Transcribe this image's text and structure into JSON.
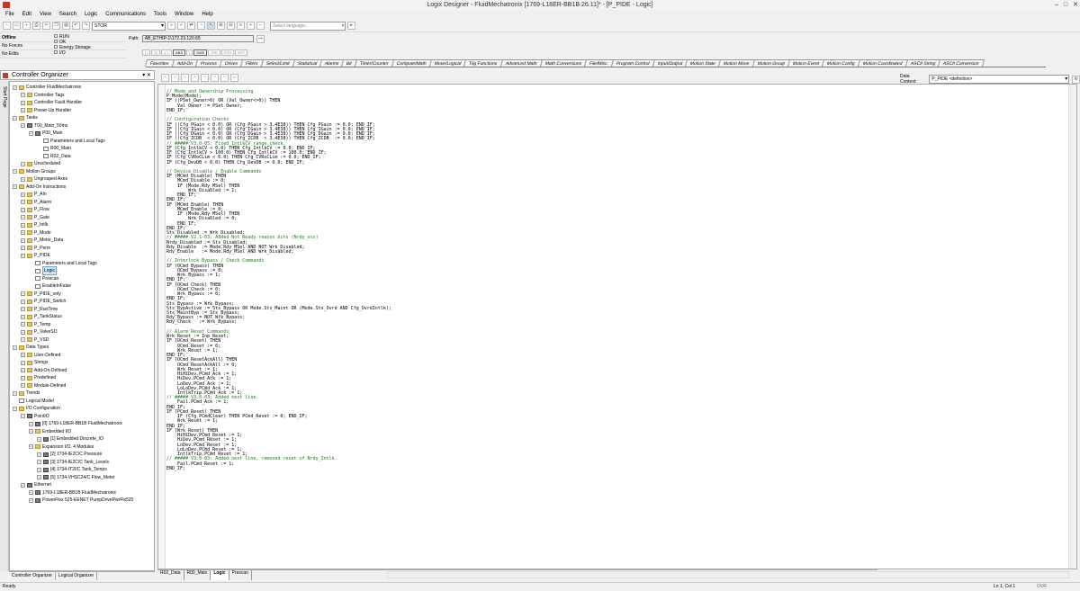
{
  "window": {
    "title": "Logix Designer - FluidMechatronix [1769-L18ER-BB1B 26.11]* - [P_PIDE - Logic]"
  },
  "menu": [
    "File",
    "Edit",
    "View",
    "Search",
    "Logic",
    "Communications",
    "Tools",
    "Window",
    "Help"
  ],
  "toolbar": {
    "search_combo": "STOR",
    "language_placeholder": "Select language..."
  },
  "controller_status": {
    "mode": "Offline",
    "forces": "No Forces",
    "edits": "No Edits",
    "leds": [
      "RUN",
      "OK",
      "Energy Storage",
      "I/O"
    ]
  },
  "path": {
    "label": "Path:",
    "value": "AB_ETHIP-1\\172.23.120.65"
  },
  "ladder_buttons": [
    "[ ]",
    "]/[",
    "-( )-",
    "ABS",
    "]",
    "SIZE",
    "JSR",
    "OTU",
    "RET"
  ],
  "instruction_tabs": [
    "Favorites",
    "Add-On",
    "Process",
    "Drives",
    "Filters",
    "Select/Limit",
    "Statistical",
    "Alarms",
    "Bit",
    "Timer/Counter",
    "Compute/Math",
    "Move/Logical",
    "Trig Functions",
    "Advanced Math",
    "Math Conversions",
    "File/Misc.",
    "Program Control",
    "Input/Output",
    "Motion State",
    "Motion Move",
    "Motion Group",
    "Motion Event",
    "Motion Config",
    "Motion Coordinated",
    "ASCII String",
    "ASCII Conversion"
  ],
  "organizer": {
    "title": "Controller Organizer",
    "vertical_tab": "Start Page",
    "bottom_tabs": [
      "Controller Organizer",
      "Logical Organizer"
    ],
    "tree": [
      {
        "level": 0,
        "text": "Controller FluidMechatronix",
        "icon": "folder"
      },
      {
        "level": 1,
        "text": "Controller Tags",
        "icon": "folder"
      },
      {
        "level": 1,
        "text": "Controller Fault Handler",
        "icon": "folder"
      },
      {
        "level": 1,
        "text": "Power-Up Handler",
        "icon": "folder"
      },
      {
        "level": 0,
        "text": "Tasks",
        "icon": "folder"
      },
      {
        "level": 1,
        "text": "T00_Main_50ms",
        "icon": "task"
      },
      {
        "level": 2,
        "text": "P00_Main",
        "icon": "program"
      },
      {
        "level": 3,
        "text": "Parameters and Local Tags",
        "icon": "doc"
      },
      {
        "level": 3,
        "text": "R00_Main",
        "icon": "doc"
      },
      {
        "level": 3,
        "text": "R02_Data",
        "icon": "doc"
      },
      {
        "level": 1,
        "text": "Unscheduled",
        "icon": "folder"
      },
      {
        "level": 0,
        "text": "Motion Groups",
        "icon": "folder"
      },
      {
        "level": 1,
        "text": "Ungrouped Axes",
        "icon": "folder"
      },
      {
        "level": 0,
        "text": "Add-On Instructions",
        "icon": "folder"
      },
      {
        "level": 1,
        "text": "P_AIn",
        "icon": "folder"
      },
      {
        "level": 1,
        "text": "P_Alarm",
        "icon": "folder"
      },
      {
        "level": 1,
        "text": "P_Flow",
        "icon": "folder"
      },
      {
        "level": 1,
        "text": "P_Gate",
        "icon": "folder"
      },
      {
        "level": 1,
        "text": "P_Intlk",
        "icon": "folder"
      },
      {
        "level": 1,
        "text": "P_Mode",
        "icon": "folder"
      },
      {
        "level": 1,
        "text": "P_Motor_Data",
        "icon": "folder"
      },
      {
        "level": 1,
        "text": "P_Perm",
        "icon": "folder"
      },
      {
        "level": 1,
        "text": "P_PIDE",
        "icon": "folder"
      },
      {
        "level": 2,
        "text": "Parameters and Local Tags",
        "icon": "doc"
      },
      {
        "level": 2,
        "text": "Logic",
        "icon": "doc",
        "selected": true
      },
      {
        "level": 2,
        "text": "Prescan",
        "icon": "doc"
      },
      {
        "level": 2,
        "text": "EnableInFalse",
        "icon": "doc"
      },
      {
        "level": 1,
        "text": "P_PIDE_only",
        "icon": "folder"
      },
      {
        "level": 1,
        "text": "P_PIDE_Switch",
        "icon": "folder"
      },
      {
        "level": 1,
        "text": "P_RunTime",
        "icon": "folder"
      },
      {
        "level": 1,
        "text": "P_TankStatus",
        "icon": "folder"
      },
      {
        "level": 1,
        "text": "P_Temp",
        "icon": "folder"
      },
      {
        "level": 1,
        "text": "P_ValveSO",
        "icon": "folder"
      },
      {
        "level": 1,
        "text": "P_VSD",
        "icon": "folder"
      },
      {
        "level": 0,
        "text": "Data Types",
        "icon": "folder"
      },
      {
        "level": 1,
        "text": "User-Defined",
        "icon": "folder"
      },
      {
        "level": 1,
        "text": "Strings",
        "icon": "folder"
      },
      {
        "level": 1,
        "text": "Add-On-Defined",
        "icon": "folder"
      },
      {
        "level": 1,
        "text": "Predefined",
        "icon": "folder"
      },
      {
        "level": 1,
        "text": "Module-Defined",
        "icon": "folder"
      },
      {
        "level": 0,
        "text": "Trends",
        "icon": "folder"
      },
      {
        "level": 0,
        "text": "Logical Model",
        "icon": "doc"
      },
      {
        "level": 0,
        "text": "I/O Configuration",
        "icon": "folder"
      },
      {
        "level": 1,
        "text": "PointIO",
        "icon": "module"
      },
      {
        "level": 2,
        "text": "[0] 1769-L18ER-BB1B FluidMechatronix",
        "icon": "module"
      },
      {
        "level": 2,
        "text": "Embedded I/O",
        "icon": "folder"
      },
      {
        "level": 3,
        "text": "[1] Embedded Discrete_IO",
        "icon": "module"
      },
      {
        "level": 2,
        "text": "Expansion I/O, 4 Modules",
        "icon": "folder"
      },
      {
        "level": 3,
        "text": "[2] 1734-IE2C/C Pressure",
        "icon": "module"
      },
      {
        "level": 3,
        "text": "[3] 1734-IE2C/C Tank_Levels",
        "icon": "module"
      },
      {
        "level": 3,
        "text": "[4] 1734-IT2I/C Tank_Temps",
        "icon": "module"
      },
      {
        "level": 3,
        "text": "[5] 1734-VHSC24/C Flow_Meter",
        "icon": "module"
      },
      {
        "level": 1,
        "text": "Ethernet",
        "icon": "module"
      },
      {
        "level": 2,
        "text": "1769-L18ER-BB1B FluidMechatronix",
        "icon": "module"
      },
      {
        "level": 2,
        "text": "PowerFlex 525-EENET PumpDrivePwrFlx525",
        "icon": "module"
      }
    ]
  },
  "editor": {
    "data_context_label": "Data Context:",
    "data_context_value": "P_PIDE <definition>",
    "routine_tabs": [
      "R02_Data",
      "R00_Main",
      "Logic",
      "Prescan"
    ],
    "code": [
      "// Mode and Ownership Processing",
      "P_Mode(Mode);",
      "IF ((PSet_Owner>0) OR (Val_Owner<>0)) THEN",
      "    Val_Owner := PSet_Owner;",
      "END_IF;",
      "",
      "// Configuration Checks",
      "IF ((Cfg_PGain < 0.0) OR (Cfg_PGain > 3.4E38)) THEN Cfg_PGain := 0.0; END_IF;",
      "IF ((Cfg_IGain < 0.0) OR (Cfg_IGain > 3.4E38)) THEN Cfg_IGain := 0.0; END_IF;",
      "IF ((Cfg_DGain < 0.0) OR (Cfg_DGain > 3.4E38)) THEN Cfg_DGain := 0.0; END_IF;",
      "IF ((Cfg_ZCDB  < 0.0) OR (Cfg_ZCDB  > 3.4E38)) THEN Cfg_ZCDB  := 0.0; END_IF;",
      "// ##### V3.0-05: Fixed IntlkCV range check.",
      "IF (Cfg_IntlkCV < 0.0) THEN Cfg_IntlkCV := 0.0; END_IF;",
      "IF (Cfg_IntlkCV > 100.0) THEN Cfg_IntlkCV := 100.0; END_IF;",
      "IF (Cfg_CVRoCLim < 0.0) THEN Cfg_CVRoCLim := 0.0; END_IF;",
      "IF (Cfg_DevDB < 0.0) THEN Cfg_DevDB := 0.0; END_IF;",
      "",
      "// Device Disable / Enable Commands",
      "IF (MCmd_Disable) THEN",
      "    MCmd_Disable := 0;",
      "    IF (Mode.Rdy_MSel) THEN",
      "        Wrk_Disabled := 1;",
      "    END_IF;",
      "END_IF;",
      "IF (MCmd_Enable) THEN",
      "    MCmd_Enable := 0;",
      "    IF (Mode.Rdy_MSel) THEN",
      "        Wrk_Disabled := 0;",
      "    END_IF;",
      "END_IF;",
      "Sts_Disabled := Wrk_Disabled;",
      "// ##### V2.1-03: Added Not Ready reason bits (Nrdy_xxx)",
      "Nrdy_Disabled := Sts_Disabled;",
      "Rdy_Disable  := Mode.Rdy_MSel AND NOT Wrk_Disabled;",
      "Rdy_Enable   := Mode.Rdy_MSel AND Wrk_Disabled;",
      "",
      "// Interlock Bypass / Check Commands",
      "IF (OCmd_Bypass) THEN",
      "    OCmd_Bypass := 0;",
      "    Wrk_Bypass := 1;",
      "END_IF;",
      "IF (OCmd_Check) THEN",
      "    OCmd_Check := 0;",
      "    Wrk_Bypass := 0;",
      "END_IF;",
      "Sts_Bypass := Wrk_Bypass;",
      "Sts_BypActive := Sts_Bypass OR Mode.Sts_Maint OR (Mode.Sts_Ovrd AND Cfg_OvrdIntlk);",
      "Sts_MaintByp := Sts_Bypass;",
      "Rdy_Bypass := NOT Wrk_Bypass;",
      "Rdy_Check   := Wrk_Bypass;",
      "",
      "// Alarm Reset Commands",
      "Wrk_Reset := Inp_Reset;",
      "IF (OCmd_Reset) THEN",
      "    OCmd_Reset := 0;",
      "    Wrk_Reset := 1;",
      "END_IF;",
      "IF (OCmd_ResetAckAll) THEN",
      "    OCmd_ResetAckAll := 0;",
      "    Wrk_Reset := 1;",
      "    HiHiDev.PCmd_Ack := 1;",
      "    HiDev.PCmd_Ack := 1;",
      "    LoDev.PCmd_Ack := 1;",
      "    LoLoDev.PCmd_Ack := 1;",
      "    IntlkTrip.PCmd_Ack := 1;",
      "// ##### V3.0-03: Added next line.",
      "    Fail.PCmd_Ack := 1;",
      "END_IF;",
      "IF (PCmd_Reset) THEN",
      "    IF (Cfg_PCmdClear) THEN PCmd_Reset := 0; END_IF;",
      "    Wrk_Reset := 1;",
      "END_IF;",
      "IF (Wrk_Reset) THEN",
      "    HiHiDev.PCmd_Reset := 1;",
      "    HiDev.PCmd_Reset := 1;",
      "    LoDev.PCmd_Reset := 1;",
      "    LoLoDev.PCmd_Reset := 1;",
      "    IntlkTrip.PCmd_Reset := 1;",
      "// ##### V3.0-03: Added next line, removed reset of Nrdy_Intlk.",
      "    Fail.PCmd_Reset := 1;",
      "END_IF;"
    ]
  },
  "statusbar": {
    "text": "Ready",
    "position": "Ln 1, Col 1",
    "mode": "OVR"
  }
}
